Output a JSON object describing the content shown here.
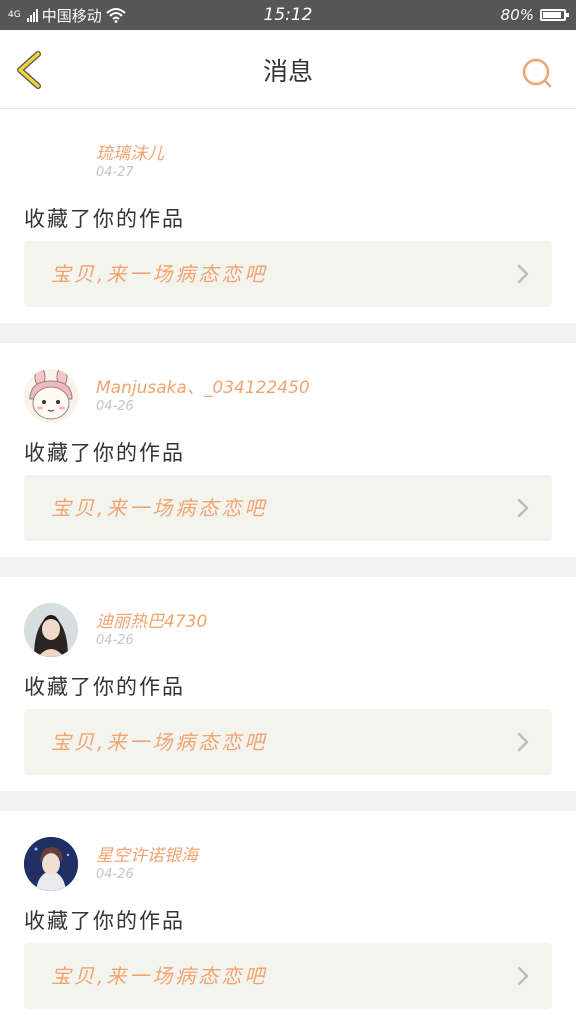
{
  "status_bar": {
    "network": "4G",
    "carrier": "中国移动",
    "time": "15:12",
    "battery": "80%",
    "icons": [
      "signal-icon",
      "wifi-icon",
      "battery-icon"
    ]
  },
  "header": {
    "title": "消息",
    "back_icon": "chevron-left-icon",
    "search_icon": "search-icon",
    "accent_color": "#f2a470",
    "back_color": "#f5d33c"
  },
  "notifications": [
    {
      "username": "琉璃沫儿",
      "date": "04-27",
      "action": "收藏了你的作品",
      "work_title": "宝贝,来一场病态恋吧",
      "avatar": "none"
    },
    {
      "username": "Manjusaka、_034122450",
      "date": "04-26",
      "action": "收藏了你的作品",
      "work_title": "宝贝,来一场病态恋吧",
      "avatar": "cartoon-bunny-avatar"
    },
    {
      "username": "迪丽热巴4730",
      "date": "04-26",
      "action": "收藏了你的作品",
      "work_title": "宝贝,来一场病态恋吧",
      "avatar": "photo-avatar"
    },
    {
      "username": "星空许诺银海",
      "date": "04-26",
      "action": "收藏了你的作品",
      "work_title": "宝贝,来一场病态恋吧",
      "avatar": "photo-avatar"
    }
  ]
}
